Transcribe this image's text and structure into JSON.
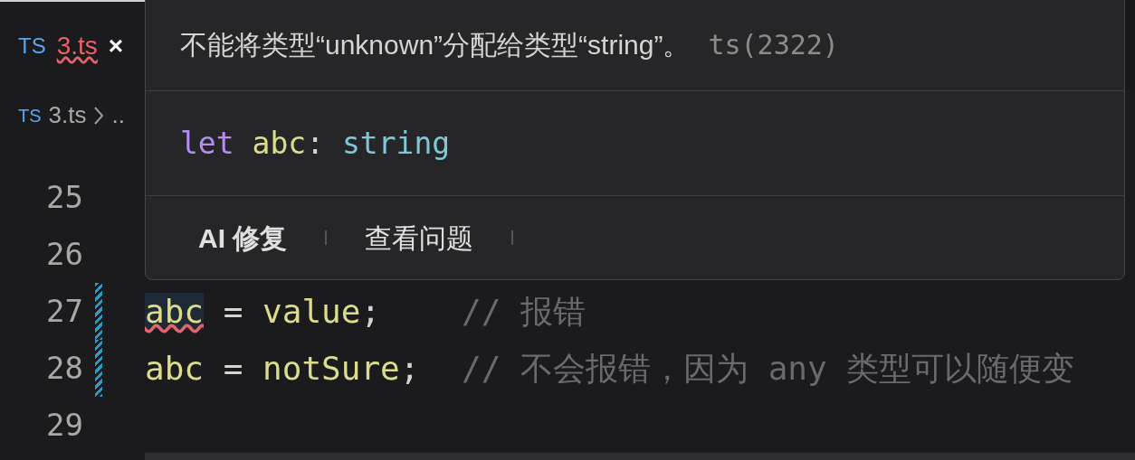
{
  "tab": {
    "lang_badge": "TS",
    "filename": "3.ts",
    "error": true,
    "close": "×"
  },
  "breadcrumb": {
    "lang_badge": "TS",
    "items": [
      "3.ts",
      ".."
    ]
  },
  "editor": {
    "lines": [
      {
        "number": "25",
        "modified": false
      },
      {
        "number": "26",
        "modified": false
      },
      {
        "number": "27",
        "modified": true,
        "tokens": [
          {
            "kind": "ident",
            "text": "abc",
            "error": true
          },
          {
            "kind": "op",
            "text": " = "
          },
          {
            "kind": "ident",
            "text": "value"
          },
          {
            "kind": "punct",
            "text": ";"
          },
          {
            "kind": "comment",
            "text": "// 报错"
          }
        ]
      },
      {
        "number": "28",
        "modified": true,
        "tokens": [
          {
            "kind": "ident",
            "text": "abc",
            "error": false
          },
          {
            "kind": "op",
            "text": " = "
          },
          {
            "kind": "ident",
            "text": "notSure"
          },
          {
            "kind": "punct",
            "text": ";"
          },
          {
            "kind": "comment",
            "text": "// 不会报错，因为 any 类型可以随便变"
          }
        ]
      },
      {
        "number": "29",
        "modified": false
      }
    ]
  },
  "hover": {
    "message": "不能将类型“unknown”分配给类型“string”。",
    "code": "ts(2322)",
    "signature": [
      {
        "kind": "keyword",
        "text": "let"
      },
      {
        "kind": "ident",
        "text": "abc"
      },
      {
        "kind": "punct",
        "text": ": "
      },
      {
        "kind": "type",
        "text": "string"
      }
    ],
    "actions": [
      "AI 修复",
      "查看问题"
    ]
  }
}
